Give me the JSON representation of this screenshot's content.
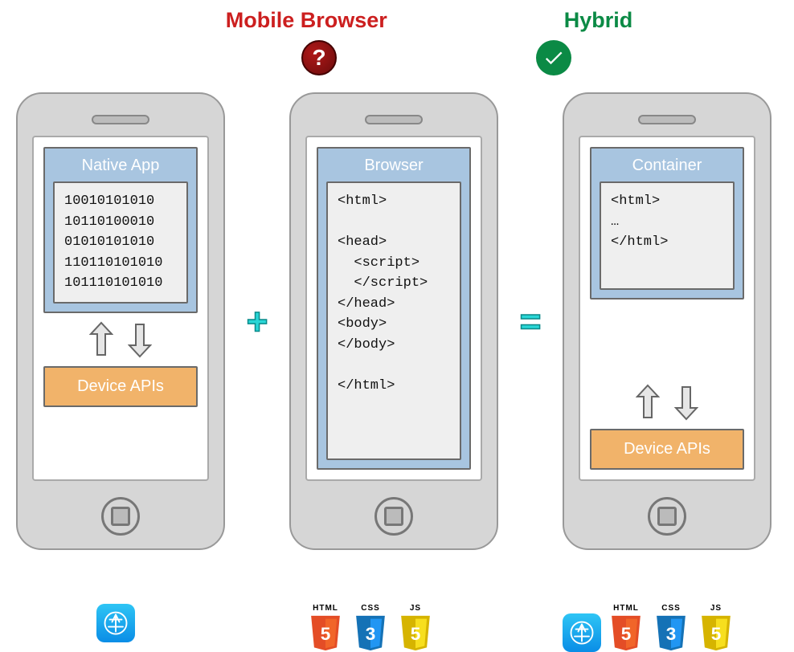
{
  "titles": {
    "mobile_browser": "Mobile Browser",
    "hybrid": "Hybrid"
  },
  "badges": {
    "question": "?",
    "check": "checkmark"
  },
  "operators": {
    "plus": "+",
    "equals": "="
  },
  "phones": {
    "native": {
      "panel_title": "Native App",
      "code": "10010101010\n10110100010\n01010101010\n110110101010\n101110101010",
      "device_apis": "Device APIs"
    },
    "browser": {
      "panel_title": "Browser",
      "code": "<html>\n\n<head>\n  <script>\n  </script>\n</head>\n<body>\n</body>\n\n</html>"
    },
    "hybrid": {
      "panel_title": "Container",
      "code": "<html>\n…\n</html>",
      "device_apis": "Device APIs"
    }
  },
  "tech": {
    "html5": {
      "label": "HTML",
      "num": "5",
      "color": "#e44d26",
      "accent": "#f16529"
    },
    "css3": {
      "label": "CSS",
      "num": "3",
      "color": "#1572b6",
      "accent": "#2196f3"
    },
    "js": {
      "label": "JS",
      "num": "5",
      "color": "#d6b400",
      "accent": "#f7df1e"
    }
  },
  "icons": {
    "app_store": "app-store-logo"
  }
}
